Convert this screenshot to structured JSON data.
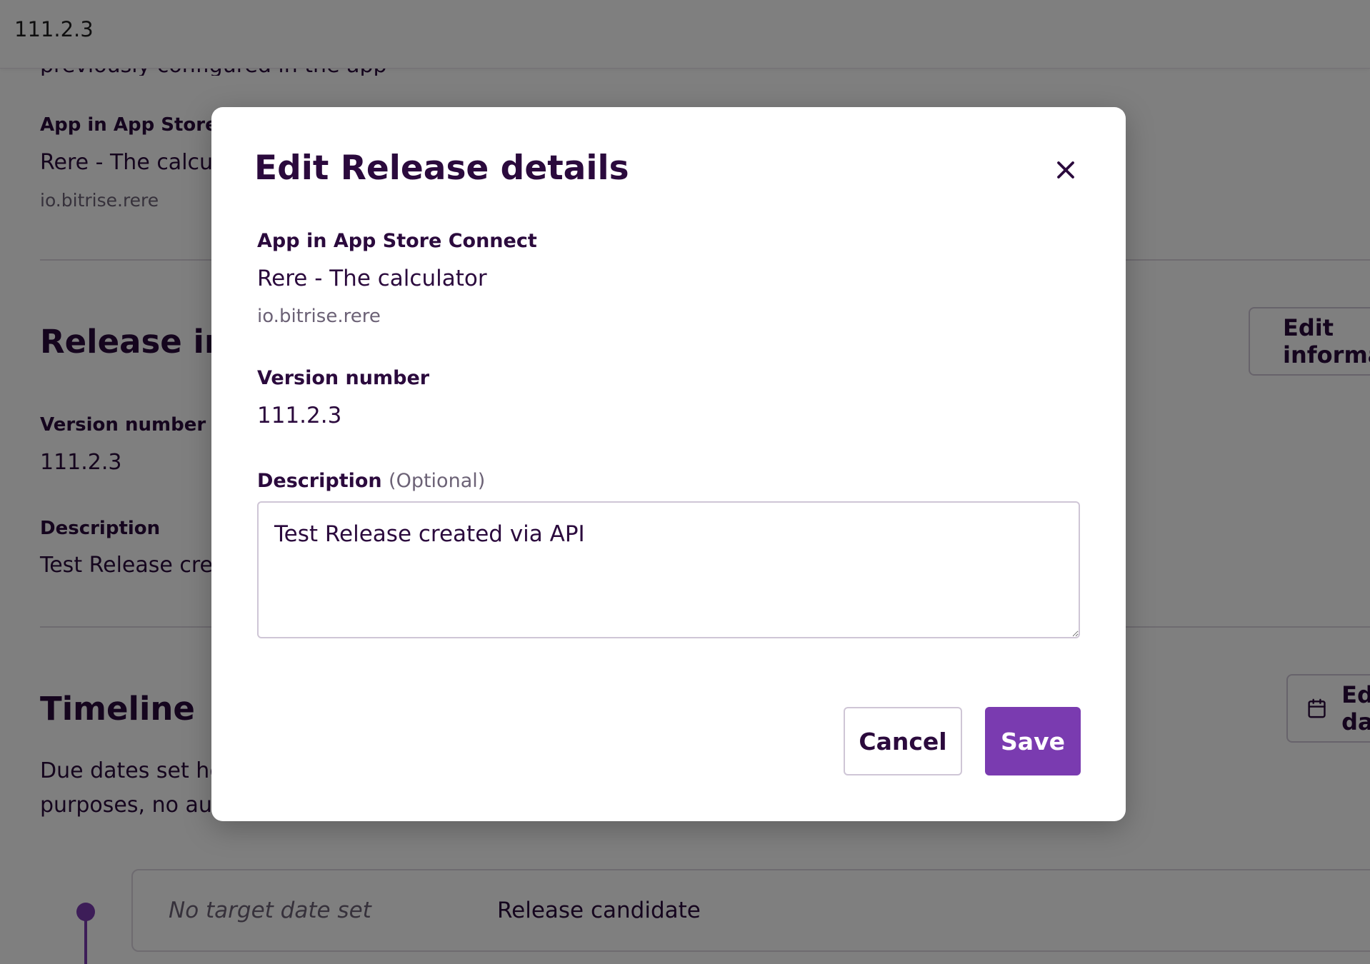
{
  "topbar": {
    "version": "111.2.3"
  },
  "background": {
    "partial_text": "previously configured in the app settings",
    "partial_link": "app settings",
    "app_section": {
      "label": "App in App Store Connect",
      "app_name": "Rere - The calculator",
      "bundle_id": "io.bitrise.rere"
    },
    "release_info": {
      "heading": "Release information",
      "edit_button": "Edit information",
      "version_label": "Version number",
      "version_value": "111.2.3",
      "description_label": "Description",
      "description_value": "Test Release created via API"
    },
    "timeline": {
      "heading": "Timeline",
      "edit_button": "Edit dates",
      "paragraph_line1": "Due dates set here are for informational",
      "paragraph_line2": "purposes, no automations are triggered",
      "items": [
        {
          "date": "No target date set",
          "name": "Release candidate"
        }
      ]
    }
  },
  "modal": {
    "title": "Edit Release details",
    "app_label": "App in App Store Connect",
    "app_name": "Rere - The calculator",
    "bundle_id": "io.bitrise.rere",
    "version_label": "Version number",
    "version_value": "111.2.3",
    "description_label": "Description",
    "description_optional": "(Optional)",
    "description_value": "Test Release created via API",
    "cancel_label": "Cancel",
    "save_label": "Save"
  },
  "colors": {
    "accent": "#7a3bb0",
    "text": "#2b0a3d",
    "muted": "#6c6276",
    "overlay": "rgba(0,0,0,0.5)"
  },
  "icons": {
    "close": "close-icon",
    "edit": "pencil-square-icon",
    "calendar": "calendar-icon"
  }
}
